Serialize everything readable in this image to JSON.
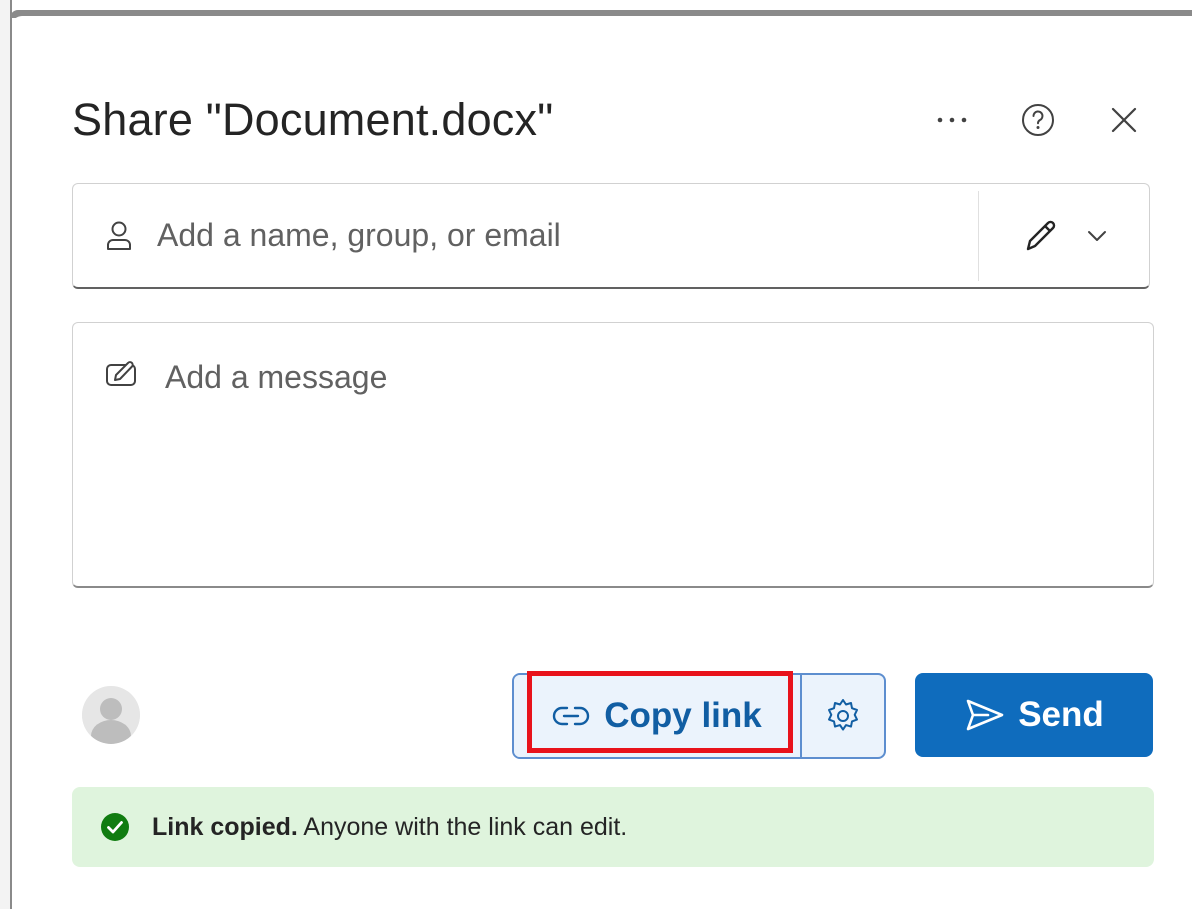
{
  "dialog": {
    "title": "Share \"Document.docx\""
  },
  "header": {
    "more_options": "More options",
    "help": "Help",
    "close": "Close"
  },
  "recipients": {
    "placeholder": "Add a name, group, or email",
    "value": "",
    "permission_icon": "pencil-icon"
  },
  "message": {
    "placeholder": "Add a message",
    "value": ""
  },
  "actions": {
    "copy_link_label": "Copy link",
    "send_label": "Send"
  },
  "toast": {
    "strong": "Link copied.",
    "text": " Anyone with the link can edit."
  },
  "colors": {
    "accent": "#0f6cbd",
    "copy_link_text": "#115ea3",
    "success_bg": "#dff4dd",
    "success_icon": "#107c10",
    "highlight": "#e8121b"
  }
}
